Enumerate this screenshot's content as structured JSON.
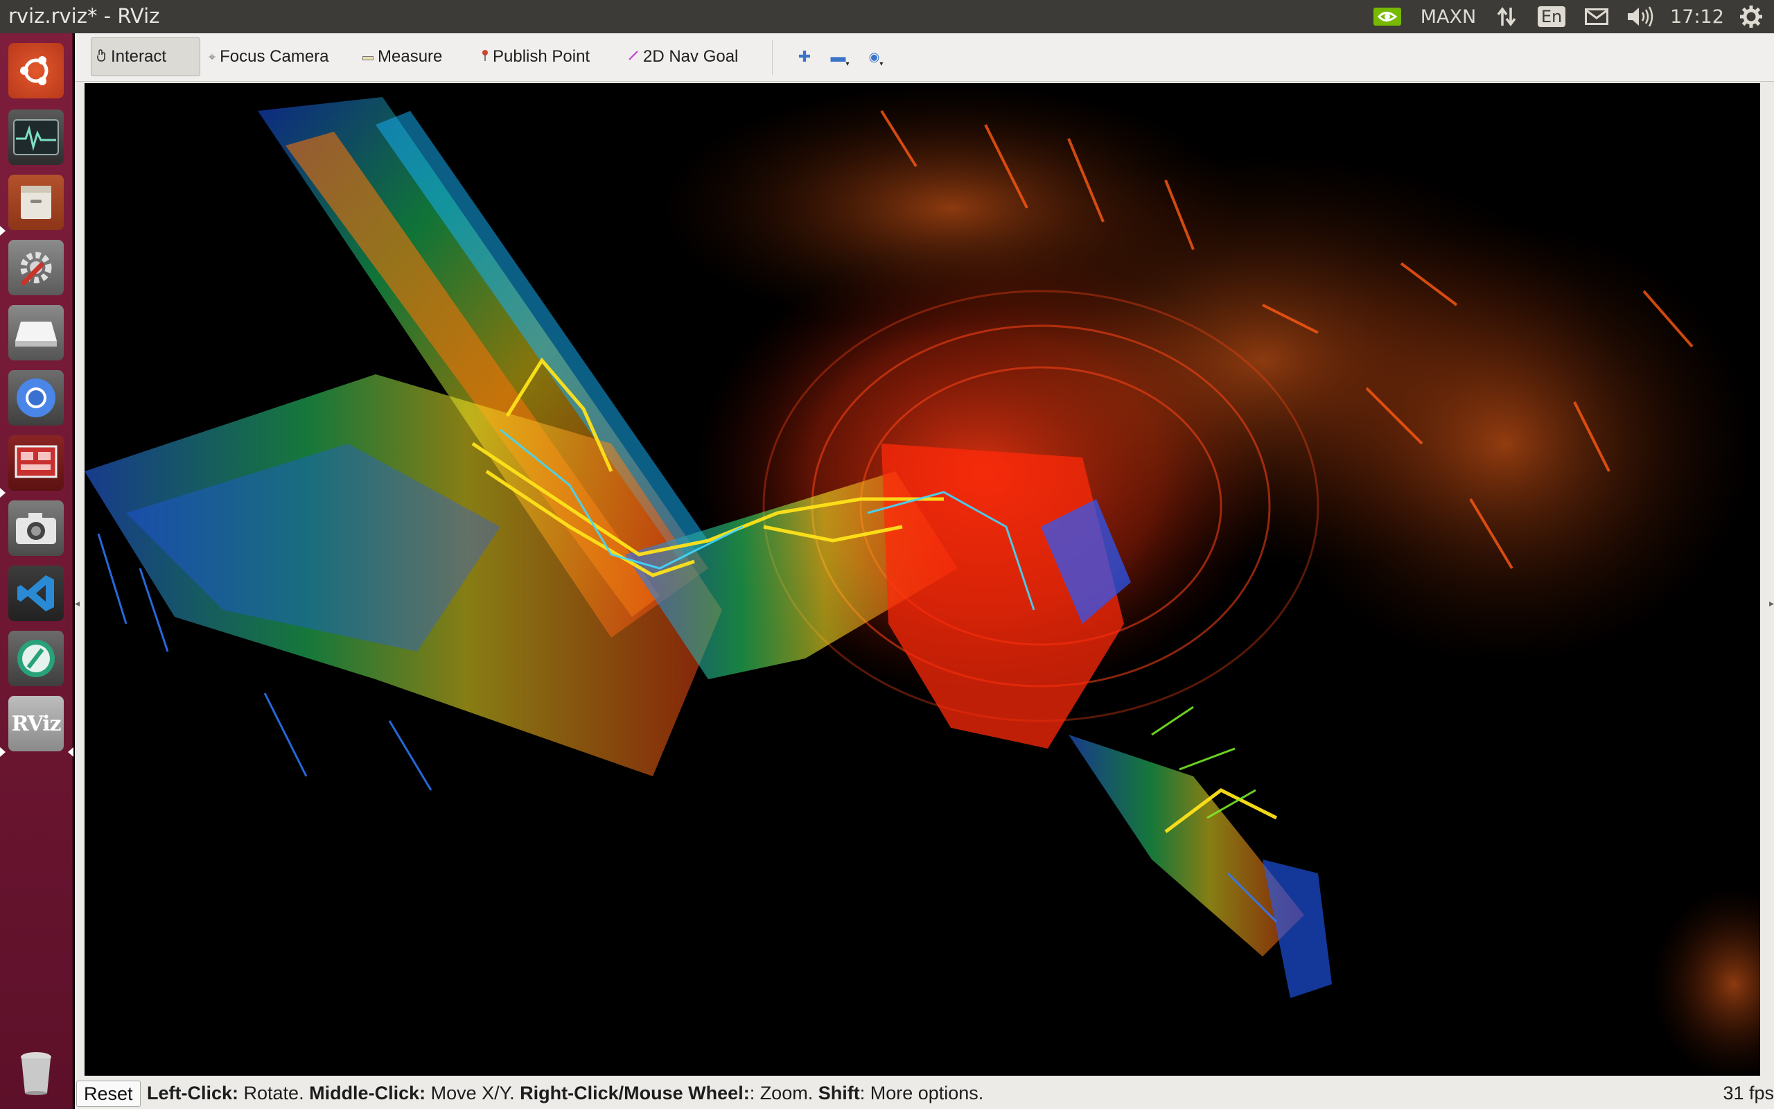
{
  "window": {
    "title": "rviz.rviz* - RViz"
  },
  "top_panel": {
    "power_mode": "MAXN",
    "keyboard_layout": "En",
    "clock": "17:12",
    "tray_icons": [
      "nvidia-icon",
      "network-arrows-icon",
      "mail-icon",
      "volume-icon",
      "gear-icon"
    ]
  },
  "launcher": {
    "items": [
      {
        "name": "ubuntu-dash",
        "icon": "ubuntu-logo-icon"
      },
      {
        "name": "system-monitor",
        "icon": "activity-graph-icon"
      },
      {
        "name": "files",
        "icon": "file-cabinet-icon"
      },
      {
        "name": "system-settings",
        "icon": "settings-wrench-icon"
      },
      {
        "name": "drive",
        "icon": "drive-icon"
      },
      {
        "name": "chromium",
        "icon": "chromium-icon"
      },
      {
        "name": "presentation",
        "icon": "presentation-icon"
      },
      {
        "name": "camera",
        "icon": "camera-icon"
      },
      {
        "name": "vscode",
        "icon": "vscode-icon"
      },
      {
        "name": "system-cleaner",
        "icon": "broom-icon"
      },
      {
        "name": "rviz",
        "icon": "rviz-icon",
        "label": "RViz"
      }
    ],
    "trash_icon": "trash-icon"
  },
  "toolbar": {
    "tools": [
      {
        "label": "Interact",
        "icon": "hand-icon",
        "active": true
      },
      {
        "label": "Focus Camera",
        "icon": "crosshair-icon",
        "active": false
      },
      {
        "label": "Measure",
        "icon": "ruler-icon",
        "active": false
      },
      {
        "label": "Publish Point",
        "icon": "map-pin-icon",
        "active": false
      },
      {
        "label": "2D Nav Goal",
        "icon": "nav-arrow-icon",
        "active": false
      }
    ],
    "extra_icons": [
      "add-tool-icon",
      "remove-tool-icon",
      "view-options-icon"
    ]
  },
  "status": {
    "reset_label": "Reset",
    "hint": [
      {
        "b": "Left-Click:",
        "t": " Rotate. "
      },
      {
        "b": "Middle-Click:",
        "t": " Move X/Y. "
      },
      {
        "b": "Right-Click/Mouse Wheel:",
        "t": ": Zoom. "
      },
      {
        "b": "Shift",
        "t": ": More options."
      }
    ],
    "fps": "31 fps"
  },
  "colors": {
    "panel": "#3c3b37",
    "launcher": "#7e1d3c",
    "viewport_bg": "#000000"
  }
}
